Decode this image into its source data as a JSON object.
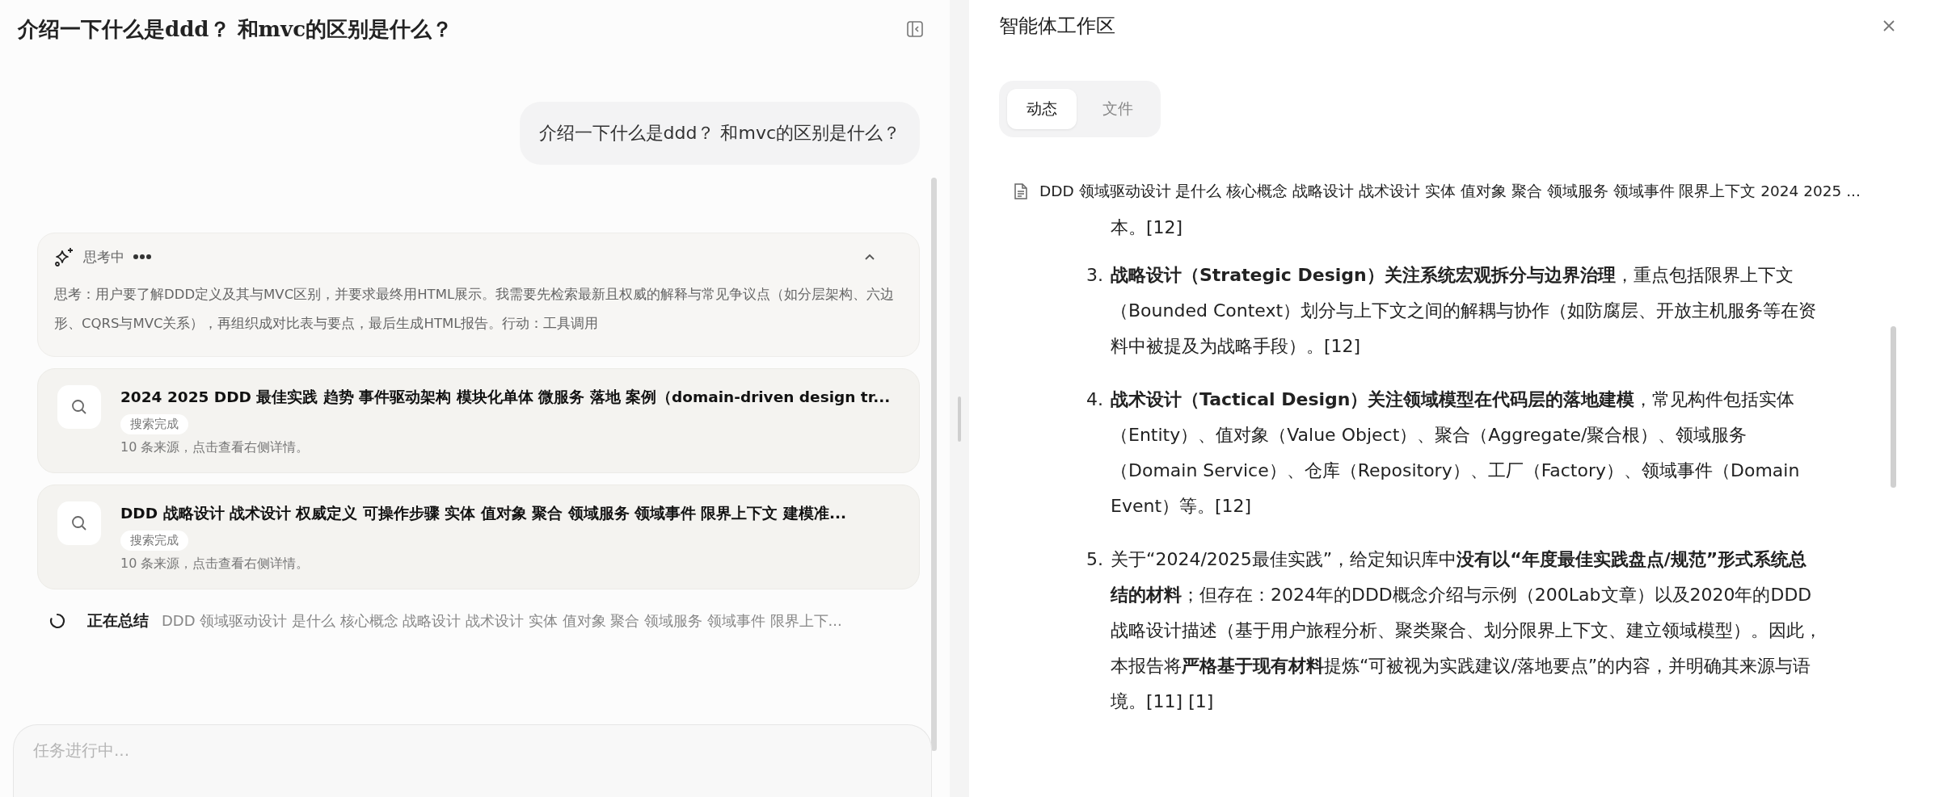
{
  "chat": {
    "title": "介绍一下什么是ddd？ 和mvc的区别是什么？",
    "user_message": "介绍一下什么是ddd？ 和mvc的区别是什么？",
    "thinking": {
      "label": "思考中",
      "expanded": true,
      "text": "思考：用户要了解DDD定义及其与MVC区别，并要求最终用HTML展示。我需要先检索最新且权威的解释与常见争议点（如分层架构、六边形、CQRS与MVC关系），再组织成对比表与要点，最后生成HTML报告。行动：工具调用"
    },
    "searches": [
      {
        "query": "2024 2025 DDD 最佳实践 趋势 事件驱动架构 模块化单体 微服务 落地 案例（domain-driven design tr...",
        "status": "搜索完成",
        "sources": "10 条来源，点击查看右侧详情。"
      },
      {
        "query": "DDD 战略设计 战术设计 权威定义 可操作步骤 实体 值对象 聚合 领域服务 领域事件 限界上下文 建模准...",
        "status": "搜索完成",
        "sources": "10 条来源，点击查看右侧详情。"
      }
    ],
    "progress": {
      "label": "正在总结",
      "running": true,
      "detail": "DDD 领域驱动设计 是什么 核心概念 战略设计 战术设计 实体 值对象 聚合 领域服务 领域事件 限界上下..."
    },
    "input": {
      "placeholder": "任务进行中..."
    }
  },
  "workspace": {
    "title": "智能体工作区",
    "tabs": [
      {
        "label": "动态",
        "selected": true
      },
      {
        "label": "文件",
        "selected": false
      }
    ],
    "document": {
      "title": "DDD 领域驱动设计 是什么 核心概念 战略设计 战术设计 实体 值对象 聚合 领域服务 领域事件 限界上下文 2024 2025 ...",
      "continuation": "本。[12]",
      "items": [
        {
          "number": "3.",
          "text": "**战略设计（Strategic Design）关注系统宏观拆分与边界治理**，重点包括限界上下文（Bounded Context）划分与上下文之间的解耦与协作（如防腐层、开放主机服务等在资料中被提及为战略手段）。[12]"
        },
        {
          "number": "4.",
          "text": "**战术设计（Tactical Design）关注领域模型在代码层的落地建模**，常见构件包括实体（Entity）、值对象（Value Object）、聚合（Aggregate/聚合根）、领域服务（Domain Service）、仓库（Repository）、工厂（Factory）、领域事件（Domain Event）等。[12]"
        },
        {
          "number": "5.",
          "text": "关于“2024/2025最佳实践”，给定知识库中**没有以“年度最佳实践盘点/规范”形式系统总结的材料**；但存在：2024年的DDD概念介绍与示例（200Lab文章）以及2020年的DDD战略设计描述（基于用户旅程分析、聚类聚合、划分限界上下文、建立领域模型）。因此，本报告将**严格基于现有材料**提炼“可被视为实践建议/落地要点”的内容，并明确其来源与语境。[11] [1]"
        }
      ]
    }
  }
}
